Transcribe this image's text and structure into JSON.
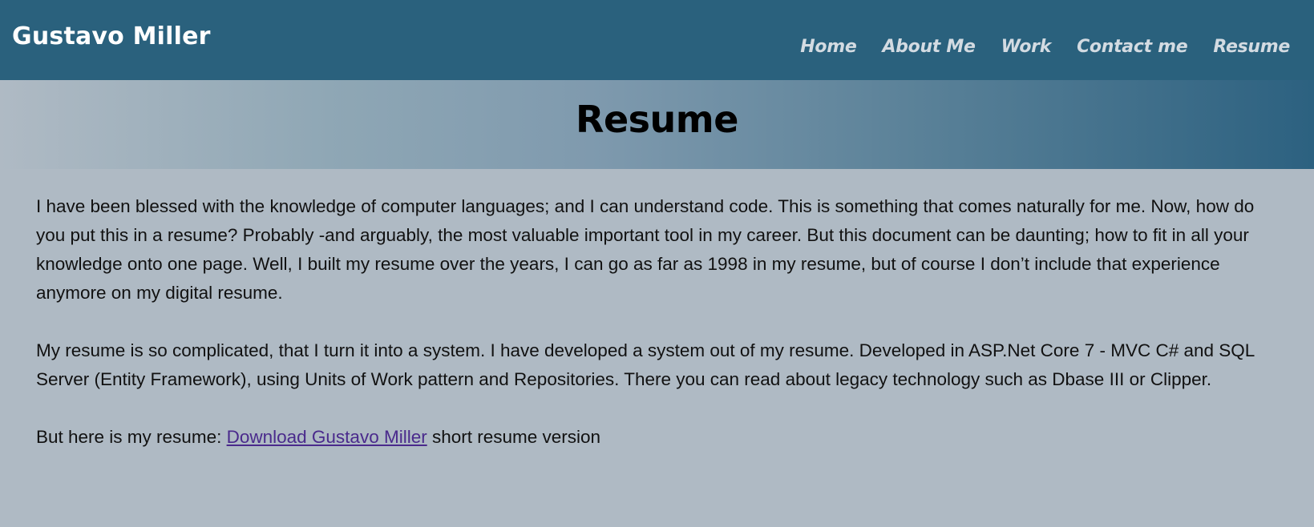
{
  "header": {
    "brand": "Gustavo Miller",
    "nav": [
      {
        "label": "Home"
      },
      {
        "label": "About Me"
      },
      {
        "label": "Work"
      },
      {
        "label": "Contact me"
      },
      {
        "label": "Resume"
      }
    ],
    "background_color": "#2a617d",
    "nav_text_color": "#d3dbe2"
  },
  "banner": {
    "title": "Resume"
  },
  "content": {
    "paragraph1": "I have been blessed with the knowledge of computer languages; and I can understand code. This is something that comes naturally for me. Now, how do you put this in a resume? Probably -and arguably, the most valuable important tool in my career. But this document can be daunting; how to fit in all your knowledge onto one page. Well, I built my resume over the years, I can go as far as 1998 in my resume, but of course I don’t include that experience anymore on my digital resume.",
    "paragraph2": "My resume is so complicated, that I turn it into a system. I have developed a system out of my resume. Developed in ASP.Net Core 7 - MVC C# and SQL Server (Entity Framework), using Units of Work pattern and Repositories. There you can read about legacy technology such as Dbase III or Clipper.",
    "download_prefix": "But here is my resume: ",
    "download_link": "Download Gustavo Miller",
    "download_suffix": " short resume version",
    "link_color": "#4a2a8c",
    "page_background": "#afbac4"
  }
}
